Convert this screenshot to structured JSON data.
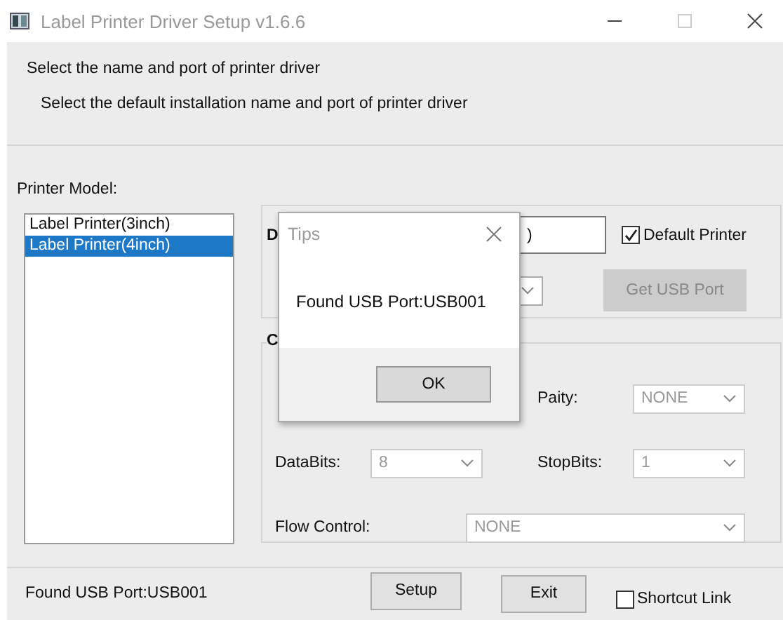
{
  "window": {
    "title": "Label Printer Driver Setup v1.6.6"
  },
  "header": {
    "title": "Select the name and port of printer driver",
    "subtitle": "Select the default installation name and port of printer driver"
  },
  "printer_model": {
    "label": "Printer Model:",
    "items": [
      {
        "label": "Label Printer(3inch)",
        "selected": false
      },
      {
        "label": "Label Printer(4inch)",
        "selected": true
      }
    ]
  },
  "driver_group": {
    "label_fragment": "D",
    "name_fragment": ")",
    "default_printer": {
      "label": "Default Printer",
      "checked": true
    },
    "get_usb_port": {
      "label": "Get USB Port",
      "disabled": true
    }
  },
  "com_group": {
    "title_fragment": "C",
    "rows": [
      [
        {
          "kind": "covered"
        },
        {
          "label": "Paity:",
          "value": "NONE",
          "kind": "short",
          "disabled": true
        }
      ],
      [
        {
          "label": "DataBits:",
          "value": "8",
          "kind": "short",
          "disabled": true
        },
        {
          "label": "StopBits:",
          "value": "1",
          "kind": "short",
          "disabled": true
        }
      ],
      [
        {
          "label": "Flow Control:",
          "value": "NONE",
          "kind": "wide",
          "disabled": true
        }
      ]
    ]
  },
  "status": "Found USB Port:USB001",
  "buttons": [
    {
      "label": "Setup"
    },
    {
      "label": "Exit"
    }
  ],
  "shortcut_link": {
    "label": "Shortcut Link",
    "checked": false
  },
  "dialog": {
    "title": "Tips",
    "message": "Found USB Port:USB001",
    "button": "OK"
  }
}
